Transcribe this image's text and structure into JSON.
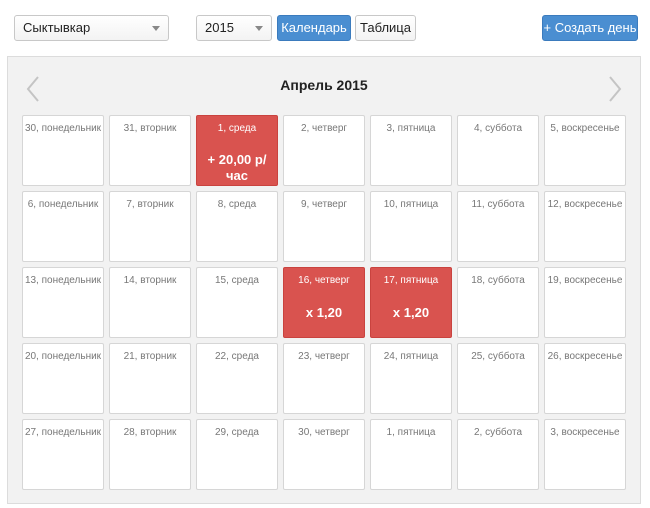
{
  "toolbar": {
    "city": "Сыктывкар",
    "year": "2015",
    "calendar_label": "Календарь",
    "table_label": "Таблица",
    "create_label": "+ Создать день",
    "accent_color": "#4a8ed1"
  },
  "calendar": {
    "month_title": "Апрель 2015",
    "highlight_color": "#d9534f",
    "weeks": [
      [
        {
          "label": "30, понедельник"
        },
        {
          "label": "31, вторник"
        },
        {
          "label": "1, среда",
          "highlight": true,
          "value": "+ 20,00 р/\nчас"
        },
        {
          "label": "2, четверг"
        },
        {
          "label": "3, пятница"
        },
        {
          "label": "4, суббота"
        },
        {
          "label": "5, воскресенье"
        }
      ],
      [
        {
          "label": "6, понедельник"
        },
        {
          "label": "7, вторник"
        },
        {
          "label": "8, среда"
        },
        {
          "label": "9, четверг"
        },
        {
          "label": "10, пятница"
        },
        {
          "label": "11, суббота"
        },
        {
          "label": "12, воскресенье"
        }
      ],
      [
        {
          "label": "13, понедельник"
        },
        {
          "label": "14, вторник"
        },
        {
          "label": "15, среда"
        },
        {
          "label": "16, четверг",
          "highlight": true,
          "value": "x 1,20"
        },
        {
          "label": "17, пятница",
          "highlight": true,
          "value": "x 1,20"
        },
        {
          "label": "18, суббота"
        },
        {
          "label": "19, воскресенье"
        }
      ],
      [
        {
          "label": "20, понедельник"
        },
        {
          "label": "21, вторник"
        },
        {
          "label": "22, среда"
        },
        {
          "label": "23, четверг"
        },
        {
          "label": "24, пятница"
        },
        {
          "label": "25, суббота"
        },
        {
          "label": "26, воскресенье"
        }
      ],
      [
        {
          "label": "27, понедельник"
        },
        {
          "label": "28, вторник"
        },
        {
          "label": "29, среда"
        },
        {
          "label": "30, четверг"
        },
        {
          "label": "1, пятница"
        },
        {
          "label": "2, суббота"
        },
        {
          "label": "3, воскресенье"
        }
      ]
    ]
  }
}
